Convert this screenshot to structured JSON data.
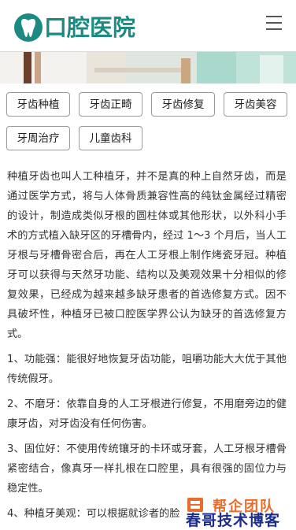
{
  "header": {
    "title": "口腔医院",
    "brand_color": "#1b8b82"
  },
  "categories": [
    "牙齿种植",
    "牙齿正畸",
    "牙齿修复",
    "牙齿美容",
    "牙周治疗",
    "儿童齿科"
  ],
  "article": {
    "paragraphs": [
      "种植牙齿也叫人工种植牙，并不是真的种上自然牙齿，而是通过医学方式，将与人体骨质兼容性高的纯钛金属经过精密的设计，制造成类似牙根的圆柱体或其他形状，以外科小手术的方式植入缺牙区的牙槽骨内，经过 1～3 个月后，当人工牙根与牙槽骨密合后，再在人工牙根上制作烤瓷牙冠。种植牙可以获得与天然牙功能、结构以及美观效果十分相似的修复效果，已经成为越来越多缺牙患者的首选修复方式。因不具破坏性，种植牙已被口腔医学界公认为缺牙的首选修复方式。",
      "1、功能强：能很好地恢复牙齿功能，咀嚼功能大大优于其他传统假牙。",
      "2、不磨牙：依靠自身的人工牙根进行修复，不用磨旁边的健康牙齿，对牙齿没有任何伤害。",
      "3、固位好：不使用传统镶牙的卡环或牙套，人工牙根牙槽骨紧密结合，像真牙一样扎根在口腔里，具有很强的固位力与稳定性。",
      "4、种植牙美观：可以根据就诊者的脸"
    ]
  },
  "watermark": {
    "logo_text": "帮企团队",
    "text": "春哥技术博客"
  }
}
